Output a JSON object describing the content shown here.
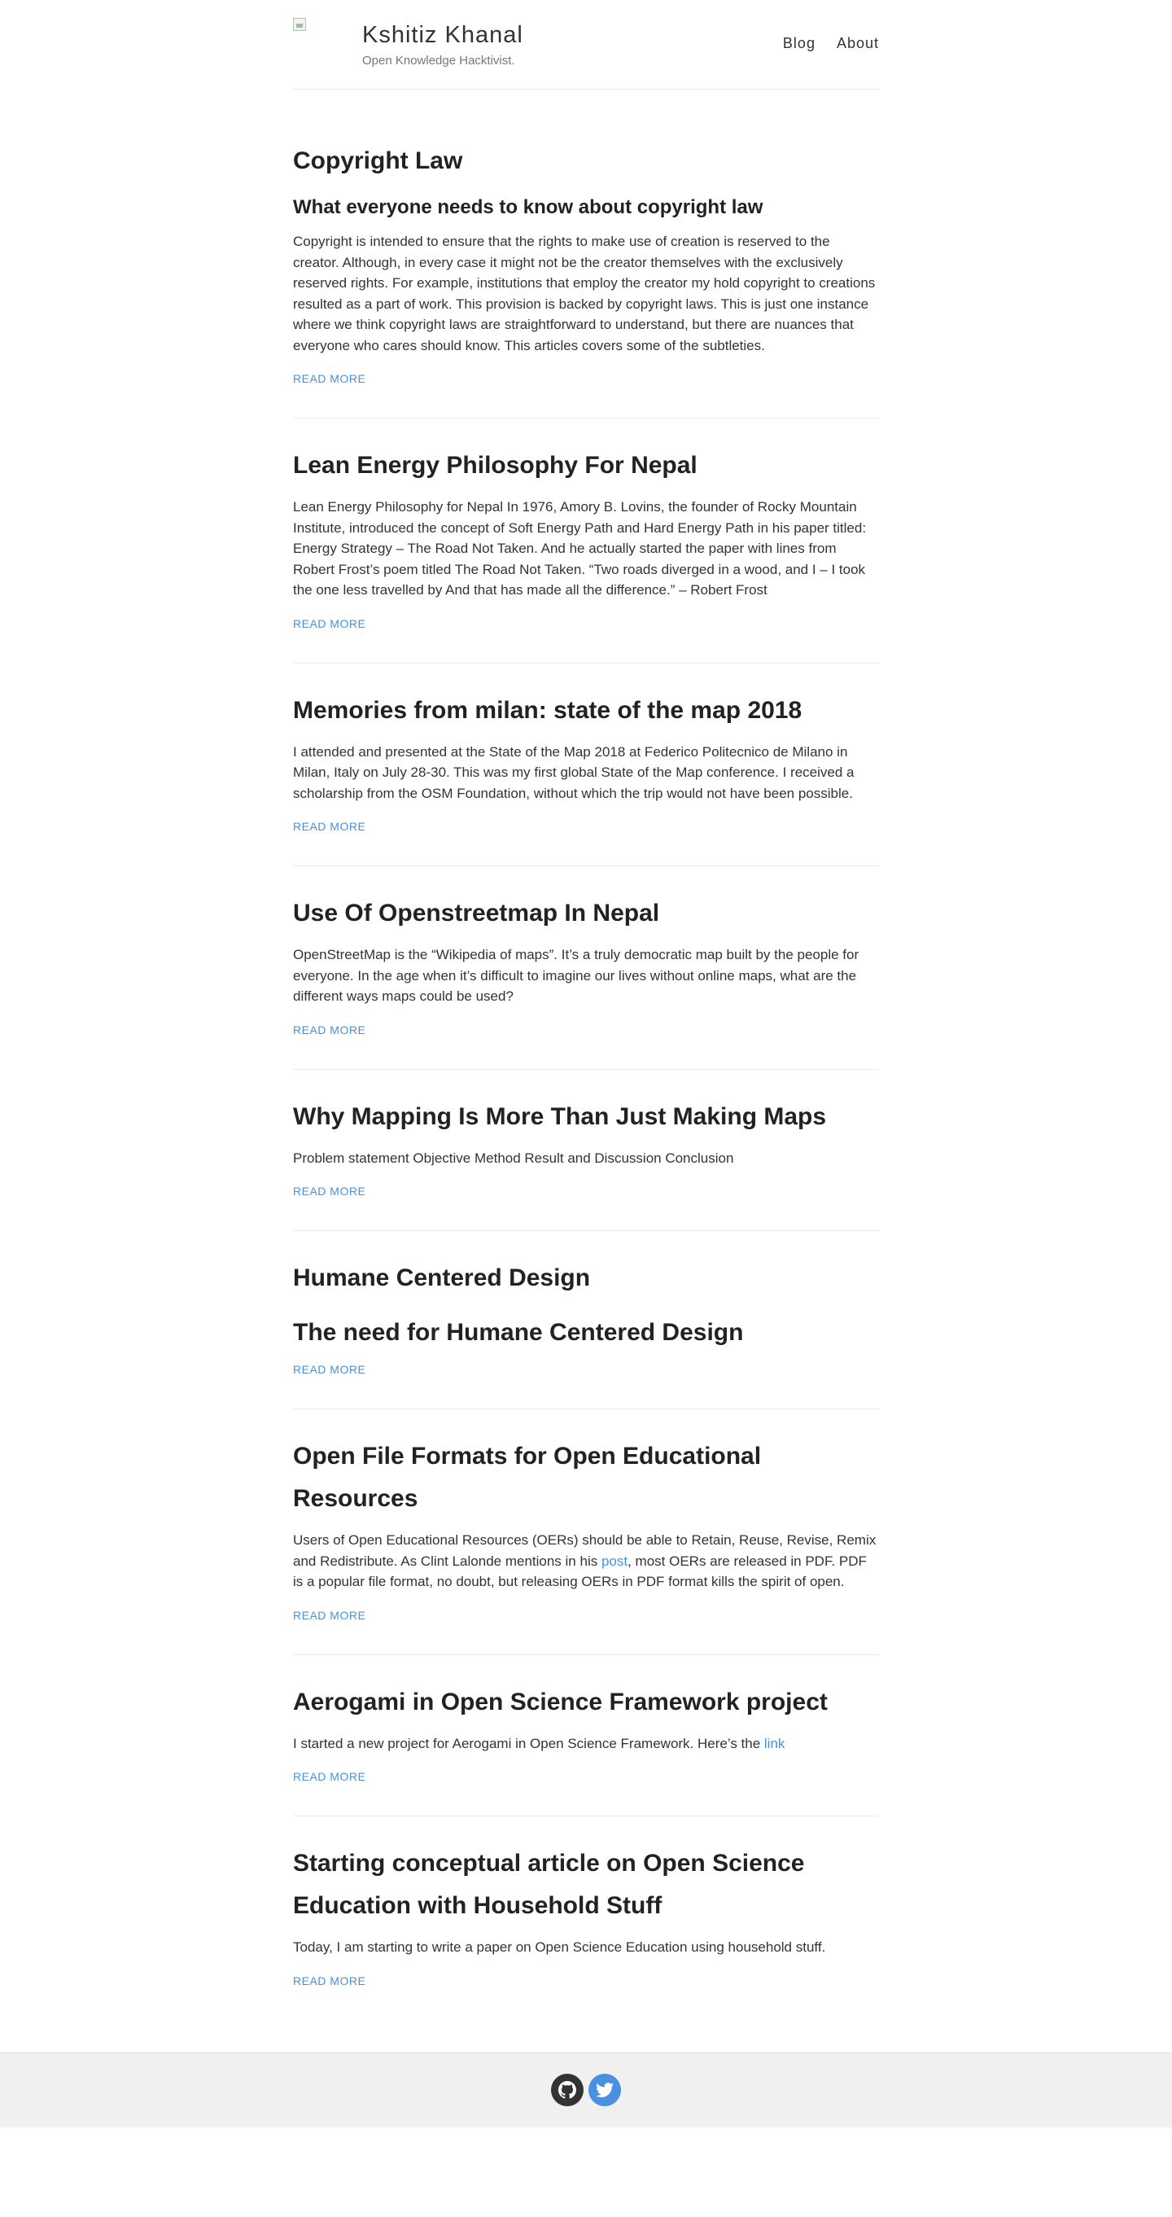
{
  "header": {
    "title": "Kshitiz Khanal",
    "description": "Open Knowledge Hacktivist.",
    "nav": [
      "Blog",
      "About"
    ]
  },
  "posts": [
    {
      "title": "Copyright Law",
      "subtitle": "What everyone needs to know about copyright law",
      "excerpt": "Copyright is intended to ensure that the rights to make use of creation is reserved to the creator. Although, in every case it might not be the creator themselves with the exclusively reserved rights. For example, institutions that employ the creator my hold copyright to creations resulted as a part of work. This provision is backed by copyright laws. This is just one instance where we think copyright laws are straightforward to understand, but there are nuances that everyone who cares should know. This articles covers some of the subtleties.",
      "read_more": "READ MORE"
    },
    {
      "title": "Lean Energy Philosophy For Nepal",
      "excerpt": "Lean Energy Philosophy for Nepal In 1976, Amory B. Lovins, the founder of Rocky Mountain Institute, introduced the concept of Soft Energy Path and Hard Energy Path in his paper titled: Energy Strategy – The Road Not Taken. And he actually started the paper with lines from Robert Frost’s poem titled The Road Not Taken. “Two roads diverged in a wood, and I – I took the one less travelled by And that has made all the difference.” – Robert Frost",
      "read_more": "READ MORE"
    },
    {
      "title": "Memories from milan: state of the map 2018",
      "excerpt": "I attended and presented at the State of the Map 2018 at Federico Politecnico de Milano in Milan, Italy on July 28-30. This was my first global State of the Map conference. I received a scholarship from the OSM Foundation, without which the trip would not have been possible.",
      "read_more": "READ MORE"
    },
    {
      "title": "Use Of Openstreetmap In Nepal",
      "excerpt": "OpenStreetMap is the “Wikipedia of maps”. It’s a truly democratic map built by the people for everyone. In the age when it’s difficult to imagine our lives without online maps, what are the different ways maps could be used?",
      "read_more": "READ MORE"
    },
    {
      "title": "Why Mapping Is More Than Just Making Maps",
      "excerpt": "Problem statement Objective Method Result and Discussion Conclusion",
      "read_more": "READ MORE"
    },
    {
      "title": "Humane Centered Design",
      "subtitle": "The need for Humane Centered Design",
      "read_more": "READ MORE"
    },
    {
      "title": "Open File Formats for Open Educational Resources",
      "excerpt_before": "Users of Open Educational Resources (OERs) should be able to Retain, Reuse, Revise, Remix and Redistribute. As Clint Lalonde mentions in his ",
      "excerpt_link": "post",
      "excerpt_after": ", most OERs are released in PDF. PDF is a popular file format, no doubt, but releasing OERs in PDF format kills the spirit of open.",
      "read_more": "READ MORE"
    },
    {
      "title": "Aerogami in Open Science Framework project",
      "excerpt_before": "I started a new project for Aerogami in Open Science Framework. Here’s the ",
      "excerpt_link": "link",
      "read_more": "READ MORE"
    },
    {
      "title": "Starting conceptual article on Open Science Education with Household Stuff",
      "excerpt": "Today, I am starting to write a paper on Open Science Education using household stuff.",
      "read_more": "READ MORE"
    }
  ],
  "footer": {
    "icons": [
      "github-icon",
      "twitter-icon"
    ]
  },
  "colors": {
    "link": "#4a90d9",
    "github": "#333333",
    "twitter": "#4a90e2",
    "footer_bg": "#f0f0f0"
  }
}
